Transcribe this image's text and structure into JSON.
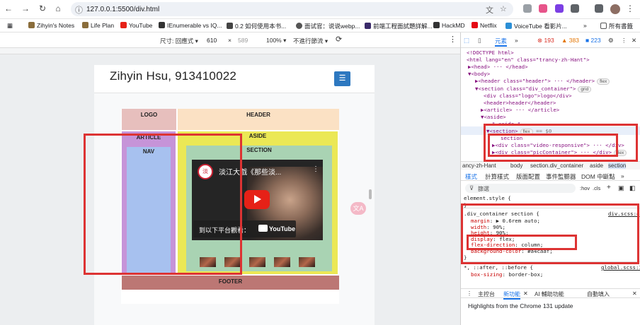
{
  "browser": {
    "url": "127.0.0.1:5500/div.html",
    "bookmarks": [
      {
        "label": "Zihyin's Notes",
        "icon": "folder-star-icon",
        "color": "#8a6d3b"
      },
      {
        "label": "Life Plan",
        "icon": "star-icon",
        "color": "#8a6d3b"
      },
      {
        "label": "YouTube",
        "icon": "youtube-icon",
        "color": "#e62117"
      },
      {
        "label": "IEnumerable vs IQ...",
        "icon": "blog-icon",
        "color": "#333333"
      },
      {
        "label": "0.2 如何使用本书...",
        "icon": "book-icon",
        "color": "#444444"
      },
      {
        "label": "面试官：说说webp...",
        "icon": "globe-icon",
        "color": "#555555"
      },
      {
        "label": "前端工程面試題詳解...",
        "icon": "e-icon",
        "color": "#3a2a6a"
      },
      {
        "label": "HackMD",
        "icon": "hackmd-icon",
        "color": "#333333"
      },
      {
        "label": "Netflix",
        "icon": "netflix-icon",
        "color": "#e50914"
      },
      {
        "label": "VoiceTube 看影片...",
        "icon": "voicetube-icon",
        "color": "#2b8fd6"
      }
    ],
    "bookmarks_more": "»",
    "all_bookmarks": "所有書籤"
  },
  "device_toolbar": {
    "size_label": "尺寸: 回應式",
    "width": "610",
    "times": "×",
    "height": "589",
    "zoom": "100%",
    "throttle": "不進行節流"
  },
  "page": {
    "title": "Zihyin Hsu, 913410022",
    "menu_icon": "☰",
    "cells": {
      "logo": "LOGO",
      "header": "HEADER",
      "article": "ARTICLE",
      "nav": "NAV",
      "aside": "ASIDE",
      "section": "SECTION",
      "footer": "FOOTER"
    },
    "video": {
      "title": "淡江大戲《那些淡...",
      "watch_on": "到以下平台觀看：",
      "youtube": "YouTube"
    },
    "translate_badge": "文A"
  },
  "devtools": {
    "tab_elements": "元素",
    "tab_more": "»",
    "errors": "193",
    "warnings": "383",
    "issues": "223",
    "elements": [
      {
        "text": "<!DOCTYPE html>",
        "indent": 8
      },
      {
        "text": "<html lang=\"en\" class=\"trancy-zh-Hant\">",
        "indent": 8
      },
      {
        "text": "▶<head> ··· </head>",
        "indent": 10
      },
      {
        "text": "▼<body>",
        "indent": 10
      },
      {
        "text": "▶<header class=\"header\"> ··· </header>",
        "indent": 20,
        "pill": "flex"
      },
      {
        "text": "▼<section class=\"div_container\">",
        "indent": 20,
        "pill": "grid"
      },
      {
        "text": "<div class=\"logo\">logo</div>",
        "indent": 32
      },
      {
        "text": "<header>header</header>",
        "indent": 32
      },
      {
        "text": "▶<article> ··· </article>",
        "indent": 28
      },
      {
        "text": "▼<aside>",
        "indent": 28
      },
      {
        "text": "\" aside \"",
        "indent": 44
      },
      {
        "text": "▼<section>",
        "indent": 36,
        "pill": "flex",
        "suffix": " == $0"
      },
      {
        "text": "section",
        "indent": 56
      },
      {
        "text": "▶<div class=\"video-responsive\"> ··· </div>",
        "indent": 44
      },
      {
        "text": "▶<div class=\"picContainer\"> ··· </div>",
        "indent": 44,
        "pill": "flex"
      }
    ],
    "breadcrumbs": [
      "ancy-zh-Hant",
      "body",
      "section.div_container",
      "aside",
      "section"
    ],
    "sub_tabs": [
      "樣式",
      "計算樣式",
      "版面配置",
      "事件監聽器",
      "DOM 中斷點",
      "»"
    ],
    "filter_placeholder": "篩選",
    "filter_tools": [
      ":hov",
      ".cls",
      "+"
    ],
    "element_style": "element.style {",
    "close_brace": "}",
    "rule_selector": ".div_container section {",
    "rule_source": "div.scss:4",
    "declarations": [
      {
        "prop": "margin",
        "value": "▶ 0.6rem auto;"
      },
      {
        "prop": "width",
        "value": "90%;"
      },
      {
        "prop": "height",
        "value": "90%;"
      },
      {
        "prop": "display",
        "value": "flex;"
      },
      {
        "prop": "flex-direction",
        "value": "column;"
      },
      {
        "prop": "background-color",
        "value": "#a4caaf;"
      }
    ],
    "universal_selector": "*, ::after, ::before {",
    "universal_source": "global.scss:1",
    "universal_decl": {
      "prop": "box-sizing",
      "value": "border-box;"
    },
    "drawer_tabs": [
      "主控台",
      "新功能",
      "AI 輔助功能",
      "自動填入"
    ],
    "drawer_active": "新功能",
    "highlights": "Highlights from the Chrome 131 update"
  },
  "colors": {
    "logo": "#e7bfbd",
    "header": "#fbe1c4",
    "article": "#c694d8",
    "nav": "#a7c1ef",
    "aside": "#ebe855",
    "section": "#a9d3b3",
    "footer": "#bc7774",
    "highlight": "#dd3333"
  }
}
